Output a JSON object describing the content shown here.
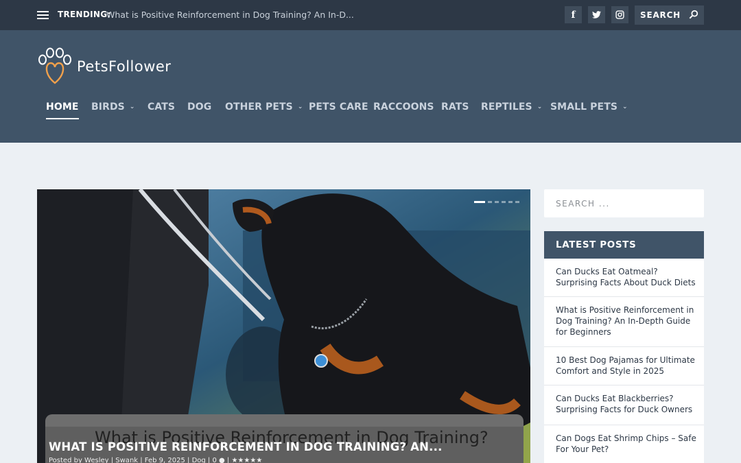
{
  "topbar": {
    "trending_label": "TRENDING:",
    "trending_text": "What is Positive Reinforcement in Dog Training? An In-D...",
    "social": [
      {
        "icon": "facebook-icon",
        "glyph": "f"
      },
      {
        "icon": "twitter-icon",
        "glyph": "t"
      },
      {
        "icon": "instagram-icon",
        "glyph": "◎"
      }
    ],
    "search_label": "SEARCH"
  },
  "header": {
    "logo_text": "PetsFollower",
    "nav": [
      {
        "label": "HOME",
        "active": true,
        "dropdown": false
      },
      {
        "label": "BIRDS",
        "active": false,
        "dropdown": true
      },
      {
        "label": "CATS",
        "active": false,
        "dropdown": false
      },
      {
        "label": "DOG",
        "active": false,
        "dropdown": false
      },
      {
        "label": "OTHER PETS",
        "active": false,
        "dropdown": true
      },
      {
        "label": "PETS CARE",
        "active": false,
        "dropdown": false
      },
      {
        "label": "RACCOONS",
        "active": false,
        "dropdown": false
      },
      {
        "label": "RATS",
        "active": false,
        "dropdown": false
      },
      {
        "label": "REPTILES",
        "active": false,
        "dropdown": true
      },
      {
        "label": "SMALL PETS",
        "active": false,
        "dropdown": true
      }
    ]
  },
  "featured": {
    "image_text": "What is Positive Reinforcement in Dog Training?",
    "title": "WHAT IS POSITIVE REINFORCEMENT IN DOG TRAINING? AN...",
    "meta": "Posted by Wesley | Swank | Feb 9, 2025 | Dog | 0 ● | ★★★★★",
    "slide_count": 6,
    "active_slide": 1
  },
  "sidebar": {
    "search_placeholder": "SEARCH ...",
    "latest_heading": "LATEST POSTS",
    "latest_posts": [
      "Can Ducks Eat Oatmeal? Surprising Facts About Duck Diets",
      "What is Positive Reinforcement in Dog Training? An In-Depth Guide for Beginners",
      "10 Best Dog Pajamas for Ultimate Comfort and Style in 2025",
      "Can Ducks Eat Blackberries? Surprising Facts for Duck Owners",
      "Can Dogs Eat Shrimp Chips – Safe For Your Pet?"
    ]
  },
  "colors": {
    "topbar": "#2d3846",
    "header": "#405468",
    "accent_orange": "#f0a04b",
    "page_bg": "#ecf0f4"
  }
}
